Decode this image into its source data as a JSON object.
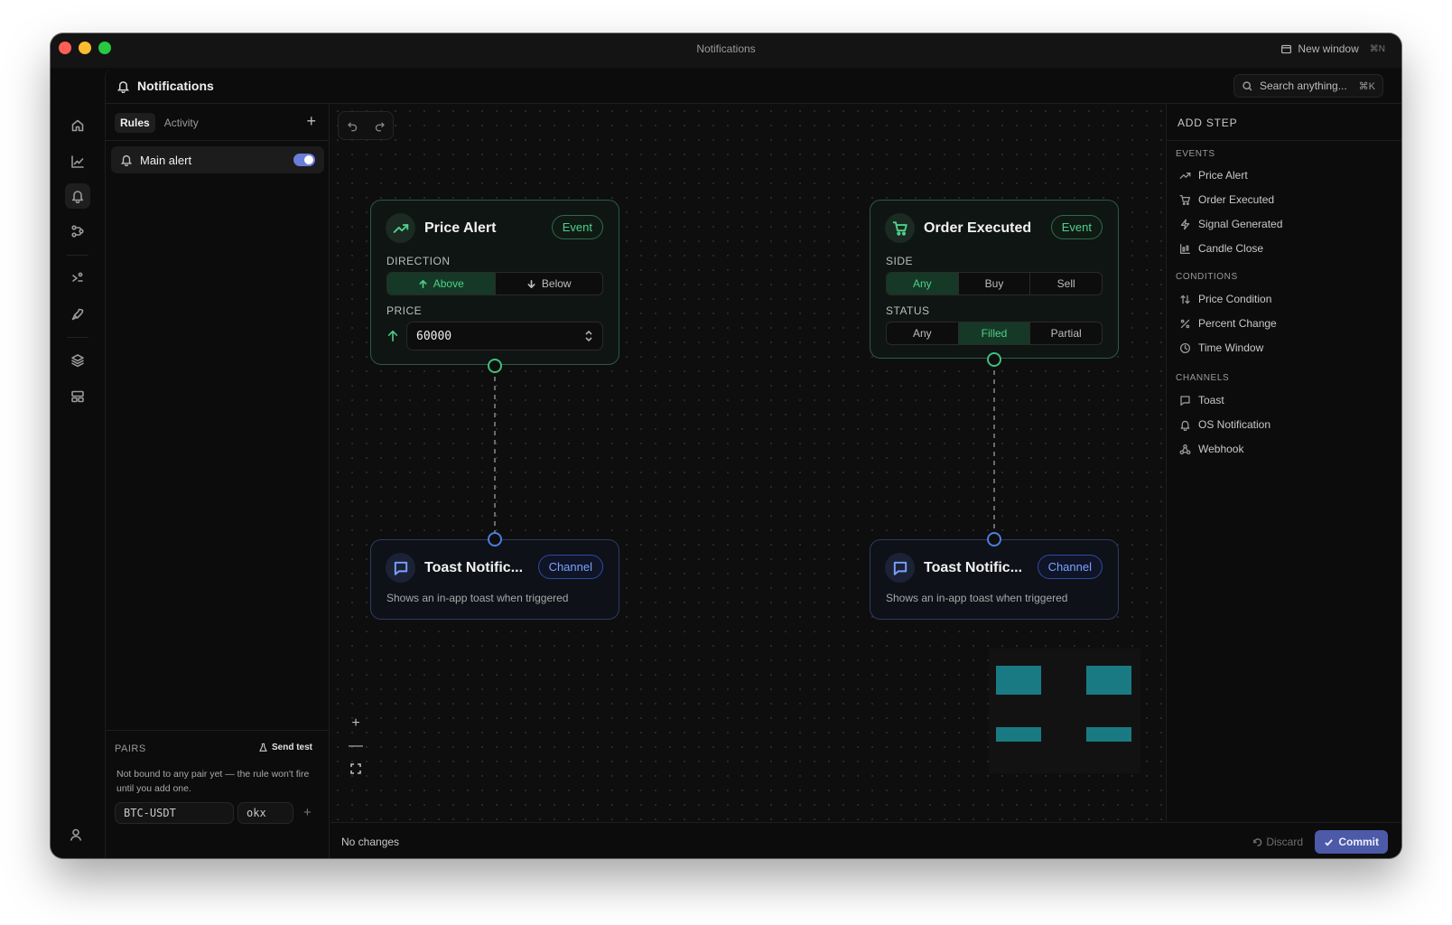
{
  "window": {
    "title": "Notifications",
    "new_window_label": "New window",
    "new_window_shortcut": "⌘N"
  },
  "header": {
    "title": "Notifications",
    "search_placeholder": "Search anything...",
    "search_shortcut": "⌘K"
  },
  "left_panel": {
    "tabs": [
      {
        "label": "Rules",
        "active": true
      },
      {
        "label": "Activity",
        "active": false
      }
    ],
    "add_label": "+",
    "rules": [
      {
        "label": "Main alert",
        "enabled": true
      }
    ],
    "pairs": {
      "title": "PAIRS",
      "send_test_label": "Send test",
      "note": "Not bound to any pair yet — the rule won't fire until you add one.",
      "symbol_value": "BTC-USDT",
      "exchange_value": "okx",
      "add_label": "+"
    }
  },
  "canvas": {
    "nodes": {
      "price_alert": {
        "title": "Price Alert",
        "badge": "Event",
        "direction_label": "DIRECTION",
        "direction_options": [
          "Above",
          "Below"
        ],
        "direction_selected": "Above",
        "price_label": "PRICE",
        "price_value": "60000"
      },
      "order_executed": {
        "title": "Order Executed",
        "badge": "Event",
        "side_label": "SIDE",
        "side_options": [
          "Any",
          "Buy",
          "Sell"
        ],
        "side_selected": "Any",
        "status_label": "STATUS",
        "status_options": [
          "Any",
          "Filled",
          "Partial"
        ],
        "status_selected": "Filled"
      },
      "toast_1": {
        "title": "Toast Notific...",
        "badge": "Channel",
        "description": "Shows an in-app toast when triggered"
      },
      "toast_2": {
        "title": "Toast Notific...",
        "badge": "Channel",
        "description": "Shows an in-app toast when triggered"
      }
    },
    "zoom_in": "+",
    "zoom_out": "—"
  },
  "bottom_bar": {
    "status": "No changes",
    "discard_label": "Discard",
    "commit_label": "Commit"
  },
  "right_panel": {
    "title": "ADD STEP",
    "sections": [
      {
        "title": "EVENTS",
        "items": [
          {
            "label": "Price Alert",
            "icon": "trending-up-icon"
          },
          {
            "label": "Order Executed",
            "icon": "cart-icon"
          },
          {
            "label": "Signal Generated",
            "icon": "bolt-icon"
          },
          {
            "label": "Candle Close",
            "icon": "candles-icon"
          }
        ]
      },
      {
        "title": "CONDITIONS",
        "items": [
          {
            "label": "Price Condition",
            "icon": "arrows-updown-icon"
          },
          {
            "label": "Percent Change",
            "icon": "percent-icon"
          },
          {
            "label": "Time Window",
            "icon": "clock-icon"
          }
        ]
      },
      {
        "title": "CHANNELS",
        "items": [
          {
            "label": "Toast",
            "icon": "message-icon"
          },
          {
            "label": "OS Notification",
            "icon": "bell-icon"
          },
          {
            "label": "Webhook",
            "icon": "webhook-icon"
          }
        ]
      }
    ]
  },
  "colors": {
    "event_accent": "#4fd08b",
    "channel_accent": "#7aa2ff",
    "commit_bg": "#4d5aa8",
    "toggle_on": "#6a7ed8"
  }
}
